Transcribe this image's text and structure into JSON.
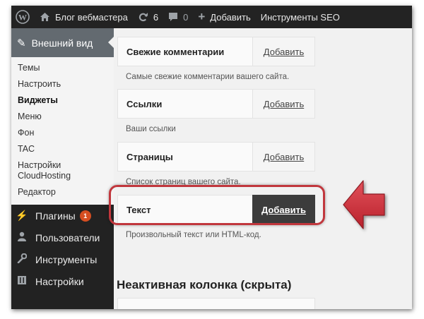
{
  "adminbar": {
    "site_name": "Блог вебмастера",
    "updates_count": "6",
    "comments_count": "0",
    "new_label": "Добавить",
    "seo_label": "Инструменты SEO"
  },
  "sidebar": {
    "current_menu": "Внешний вид",
    "submenu": [
      "Темы",
      "Настроить",
      "Виджеты",
      "Меню",
      "Фон",
      "TAC",
      "Настройки CloudHosting",
      "Редактор"
    ],
    "menu": {
      "plugins": "Плагины",
      "plugins_badge": "1",
      "users": "Пользователи",
      "tools": "Инструменты",
      "settings": "Настройки"
    }
  },
  "widgets": [
    {
      "title": "Свежие комментарии",
      "button": "Добавить",
      "desc": "Самые свежие комментарии вашего сайта."
    },
    {
      "title": "Ссылки",
      "button": "Добавить",
      "desc": "Ваши ссылки"
    },
    {
      "title": "Страницы",
      "button": "Добавить",
      "desc": "Список страниц вашего сайта."
    },
    {
      "title": "Текст",
      "button": "Добавить",
      "desc": "Произвольный текст или HTML-код."
    }
  ],
  "inactive_title": "Неактивная колонка (скрыта)",
  "colors": {
    "adminbar": "#232323",
    "sidebar": "#222222",
    "current_menu": "#636a70",
    "highlight": "#c1373d",
    "badge": "#d54e21",
    "active_button": "#3c3c3c"
  }
}
